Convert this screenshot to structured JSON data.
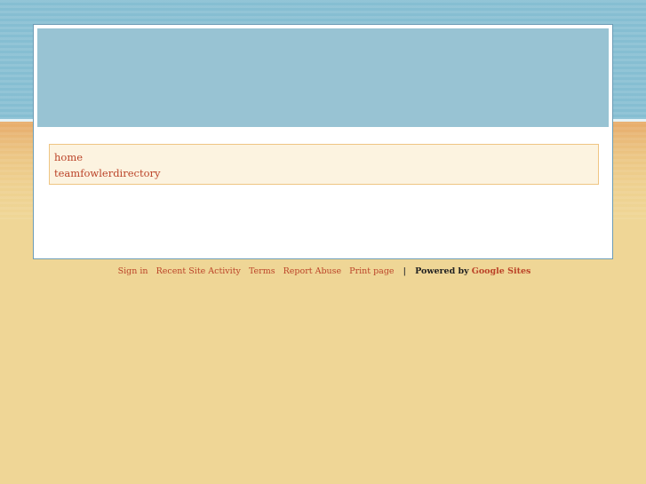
{
  "nav": {
    "items": [
      {
        "label": "home"
      },
      {
        "label": "teamfowlerdirectory"
      }
    ]
  },
  "footer": {
    "links": [
      {
        "label": "Sign in"
      },
      {
        "label": "Recent Site Activity"
      },
      {
        "label": "Terms"
      },
      {
        "label": "Report Abuse"
      },
      {
        "label": "Print page"
      }
    ],
    "separator": "|",
    "powered_by": "Powered by",
    "brand": "Google Sites"
  },
  "colors": {
    "sky": "#86bed2",
    "header": "#98c3d3",
    "sand": "#efd696",
    "link": "#bb4328",
    "nav_bg": "#fcf3e0",
    "nav_border": "#efc583"
  }
}
